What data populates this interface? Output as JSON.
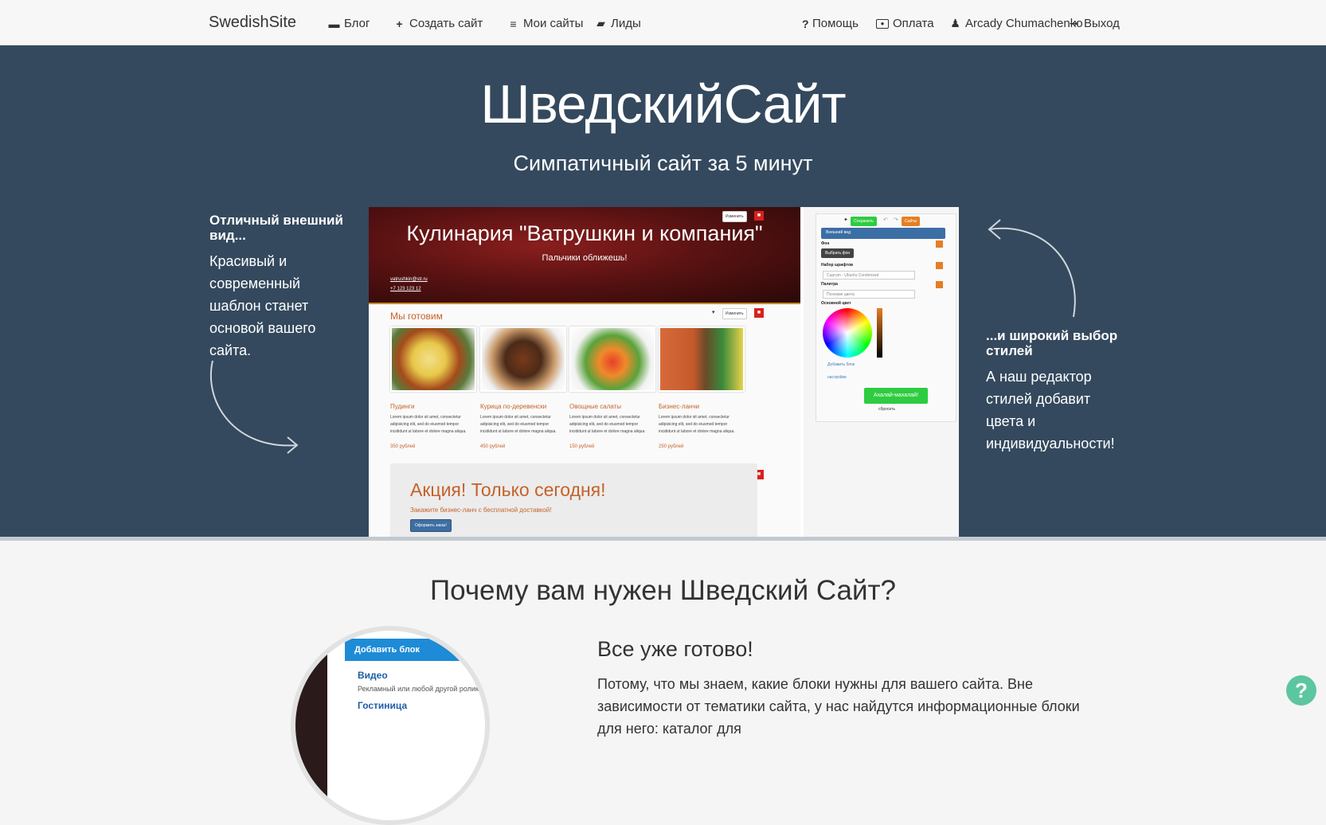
{
  "nav": {
    "brand": "SwedishSite",
    "blog": "Блог",
    "create": "Создать сайт",
    "mysites": "Мои сайты",
    "leads": "Лиды",
    "help": "Помощь",
    "payment": "Оплата",
    "user": "Arcady Chumachenko",
    "logout": "Выход",
    "icons": {
      "blog": "archive-icon",
      "create": "plus-icon",
      "mysites": "list-icon",
      "leads": "folder-open-icon",
      "help": "question-icon",
      "payment": "money-icon",
      "user": "user-icon",
      "logout": "sign-out-icon"
    }
  },
  "hero": {
    "title": "ШведскийСайт",
    "subtitle": "Симпатичный сайт за 5 минут",
    "left_heading": "Отличный внешний вид...",
    "left_text": "Красивый и современный шаблон станет основой вашего сайта.",
    "right_heading": "...и широкий выбор стилей",
    "right_text": "А наш редактор стилей добавит цвета и индивидуальности!",
    "colors": {
      "background": "#34495e",
      "text": "#ffffff"
    }
  },
  "preview": {
    "site_title": "Кулинария \"Ватрушкин и компания\"",
    "slogan": "Пальчики оближешь!",
    "email": "vatrushkin@str.ru",
    "phone": "+7 123 123 12",
    "edit_label": "Изменить",
    "section_title": "Мы готовим",
    "lorem": "Lorem ipsum dolor sit amet, consectetur adipisicing elit, sed do eiusmod tempor incididunt ut labore et dolore magna aliqua.",
    "items": [
      {
        "name": "Пудинги",
        "price": "350 рублей"
      },
      {
        "name": "Курица по-деревенски",
        "price": "450 рублей"
      },
      {
        "name": "Овощные салаты",
        "price": "150 рублей"
      },
      {
        "name": "Бизнес-ланчи",
        "price": "250 рублей"
      }
    ],
    "promo_title": "Акция! Только сегодня!",
    "promo_sub": "Закажите бизнес-ланч с бесплатной доставкой!",
    "promo_button": "Оформить заказ!",
    "colors": {
      "accent": "#c4622a",
      "header": "#6b1515",
      "delete": "#d9201e"
    }
  },
  "panel": {
    "save": "Сохранить",
    "sites": "Сайты",
    "appearance": "Внешний вид",
    "bg_label": "Фон",
    "bg_button": "Выбрать фон",
    "fonts_label": "Набор шрифтов",
    "fonts_value": "Cuprum - Ubuntu Condensed",
    "palette_label": "Палитра",
    "palette_value": "Похожие цвета",
    "base_color_label": "Основной цвет",
    "add_block": "Добавить блок",
    "settings": "настройки",
    "go_button": "Ахалай-махалай!",
    "reset": "сбросить"
  },
  "why": {
    "title": "Почему вам нужен Шведский Сайт?",
    "circle_add": "Добавить блок",
    "circle_video": "Видео",
    "circle_video_desc": "Рекламный или любой другой ролик с",
    "circle_hotel": "Гостиница",
    "ready_title": "Все уже готово!",
    "ready_text": "Потому, что мы знаем, какие блоки нужны для вашего сайта. Вне зависимости от тематики сайта, у нас найдутся информационные блоки для него: каталог для"
  },
  "help_fab": "?"
}
